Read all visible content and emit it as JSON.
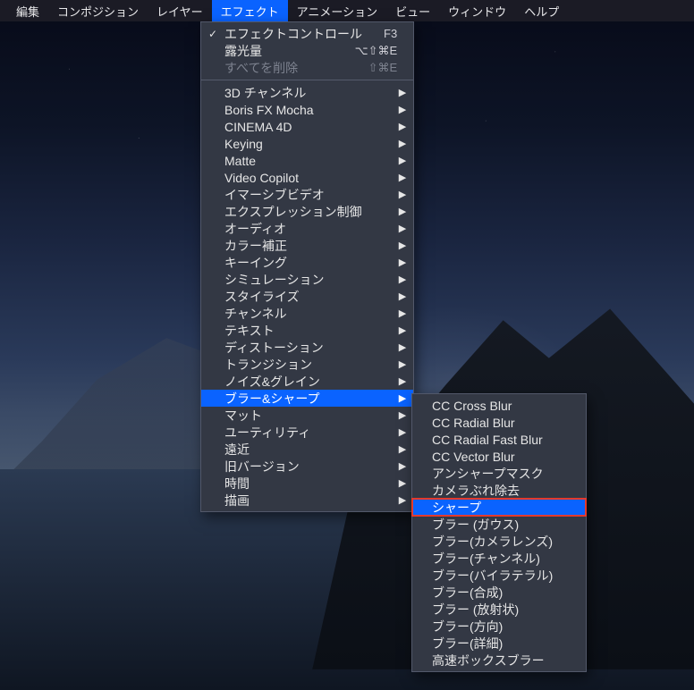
{
  "menubar": {
    "items": [
      {
        "label": "編集"
      },
      {
        "label": "コンポジション"
      },
      {
        "label": "レイヤー"
      },
      {
        "label": "エフェクト",
        "active": true
      },
      {
        "label": "アニメーション"
      },
      {
        "label": "ビュー"
      },
      {
        "label": "ウィンドウ"
      },
      {
        "label": "ヘルプ"
      }
    ]
  },
  "effectsMenu": {
    "top": [
      {
        "label": "エフェクトコントロール",
        "shortcut": "F3",
        "checked": true
      },
      {
        "label": "露光量",
        "shortcut": "⌥⇧⌘E"
      },
      {
        "label": "すべてを削除",
        "shortcut": "⇧⌘E",
        "disabled": true
      }
    ],
    "categories": [
      {
        "label": "3D チャンネル"
      },
      {
        "label": "Boris FX Mocha"
      },
      {
        "label": "CINEMA 4D"
      },
      {
        "label": "Keying"
      },
      {
        "label": "Matte"
      },
      {
        "label": "Video Copilot"
      },
      {
        "label": "イマーシブビデオ"
      },
      {
        "label": "エクスプレッション制御"
      },
      {
        "label": "オーディオ"
      },
      {
        "label": "カラー補正"
      },
      {
        "label": "キーイング"
      },
      {
        "label": "シミュレーション"
      },
      {
        "label": "スタイライズ"
      },
      {
        "label": "チャンネル"
      },
      {
        "label": "テキスト"
      },
      {
        "label": "ディストーション"
      },
      {
        "label": "トランジション"
      },
      {
        "label": "ノイズ&グレイン"
      },
      {
        "label": "ブラー&シャープ",
        "selected": true
      },
      {
        "label": "マット"
      },
      {
        "label": "ユーティリティ"
      },
      {
        "label": "遠近"
      },
      {
        "label": "旧バージョン"
      },
      {
        "label": "時間"
      },
      {
        "label": "描画"
      }
    ]
  },
  "submenu": {
    "items": [
      {
        "label": "CC Cross Blur"
      },
      {
        "label": "CC Radial Blur"
      },
      {
        "label": "CC Radial Fast Blur"
      },
      {
        "label": "CC Vector Blur"
      },
      {
        "label": "アンシャープマスク"
      },
      {
        "label": "カメラぶれ除去"
      },
      {
        "label": "シャープ",
        "highlight": true,
        "outlined": true
      },
      {
        "label": "ブラー (ガウス)"
      },
      {
        "label": "ブラー(カメラレンズ)"
      },
      {
        "label": "ブラー(チャンネル)"
      },
      {
        "label": "ブラー(バイラテラル)"
      },
      {
        "label": "ブラー(合成)"
      },
      {
        "label": "ブラー (放射状)"
      },
      {
        "label": "ブラー(方向)"
      },
      {
        "label": "ブラー(詳細)"
      },
      {
        "label": "高速ボックスブラー"
      }
    ]
  }
}
